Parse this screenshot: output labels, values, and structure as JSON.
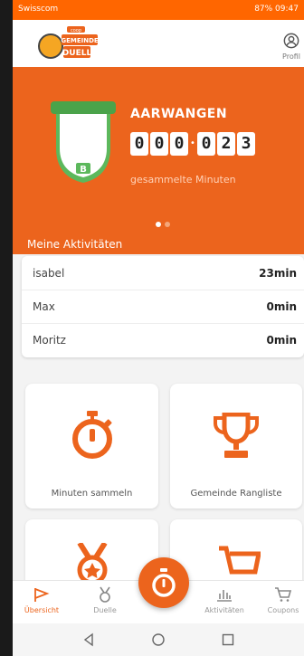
{
  "statusbar": {
    "carrier": "Swisscom",
    "right": "87% 09:47"
  },
  "header": {
    "logo_text_top": "GEMEINDE",
    "logo_text_bottom": "DUELL",
    "logo_brand": "coop",
    "profile_label": "Profil"
  },
  "hero": {
    "town": "AARWANGEN",
    "badge_letter": "B",
    "counter_digits": [
      "0",
      "0",
      "0",
      "0",
      "2",
      "3"
    ],
    "counter_caption": "gesammelte Minuten",
    "page_dots": 2,
    "active_dot": 0
  },
  "activities": {
    "title": "Meine Aktivitäten",
    "rows": [
      {
        "name": "isabel",
        "value": "23min"
      },
      {
        "name": "Max",
        "value": "0min"
      },
      {
        "name": "Moritz",
        "value": "0min"
      }
    ]
  },
  "tiles": [
    {
      "label": "Minuten sammeln",
      "icon": "stopwatch-icon"
    },
    {
      "label": "Gemeinde Rangliste",
      "icon": "trophy-icon"
    },
    {
      "label": "",
      "icon": "medal-icon"
    },
    {
      "label": "",
      "icon": "cart-icon"
    }
  ],
  "bottom_nav": [
    {
      "label": "Übersicht",
      "icon": "flag-icon",
      "active": true
    },
    {
      "label": "Duelle",
      "icon": "medal-icon",
      "active": false
    },
    {
      "label": "Aktivitäten",
      "icon": "bar-chart-icon",
      "active": false
    },
    {
      "label": "Coupons",
      "icon": "cart-icon",
      "active": false
    }
  ],
  "colors": {
    "accent": "#ec641d",
    "badge_green": "#5cb85c",
    "background": "#f3f3f3"
  }
}
